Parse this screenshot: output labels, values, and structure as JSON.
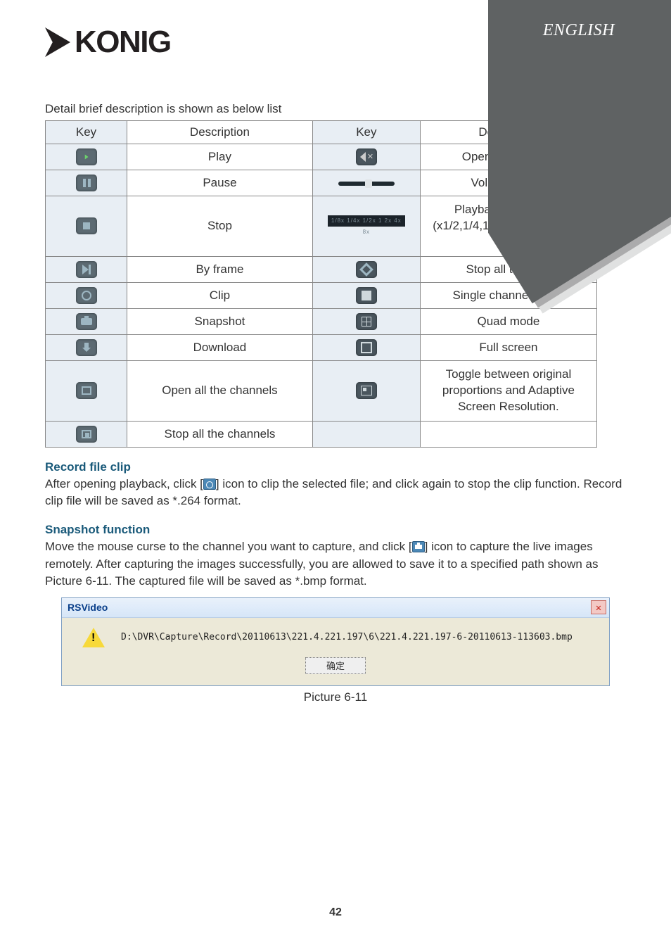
{
  "language_label": "ENGLISH",
  "logo_text": "KONIG",
  "intro": "Detail brief description is shown as below list",
  "table": {
    "headers": [
      "Key",
      "Description",
      "Key",
      "Description"
    ],
    "rows": [
      {
        "desc1": "Play",
        "key2_type": "mute",
        "desc2": "Open/close audio"
      },
      {
        "desc1": "Pause",
        "key2_type": "volume",
        "desc2": "Volume adjust"
      },
      {
        "desc1": "Stop",
        "key2_type": "speedbar",
        "desc2": "Playback control bar\n(x1/2,1/4,1/8, normal, x2, x4, x8)"
      },
      {
        "desc1": "By frame",
        "key2_type": "bigstop",
        "desc2": "Stop all the play"
      },
      {
        "desc1": "Clip",
        "key2_type": "single",
        "desc2": "Single channel mode"
      },
      {
        "desc1": "Snapshot",
        "key2_type": "quad",
        "desc2": "Quad mode"
      },
      {
        "desc1": "Download",
        "key2_type": "full",
        "desc2": "Full screen"
      },
      {
        "desc1": "Open all the channels",
        "key2_type": "toggle",
        "desc2": "Toggle between original proportions and Adaptive Screen Resolution."
      },
      {
        "desc1": "Stop all the channels",
        "key2_type": "",
        "desc2": ""
      }
    ],
    "speedbar_text": "1/8x 1/4x 1/2x  1   2x   4x   8x"
  },
  "record_clip": {
    "heading": "Record file clip",
    "text_before_icon": "After opening playback, click [",
    "text_after_icon": "] icon to clip the selected file; and click again to stop the clip function. Record clip file will be saved as *.264 format."
  },
  "snapshot": {
    "heading": "Snapshot function",
    "text_before_icon": "Move the mouse curse to the channel you want to capture, and click [",
    "text_after_icon": "] icon to capture the live images remotely. After capturing the images successfully, you are allowed to save it to a specified path shown as Picture 6-11. The captured file will be saved as *.bmp format."
  },
  "dialog": {
    "title": "RSVideo",
    "path": "D:\\DVR\\Capture\\Record\\20110613\\221.4.221.197\\6\\221.4.221.197-6-20110613-113603.bmp",
    "button": "确定"
  },
  "caption": "Picture 6-11",
  "page_number": "42"
}
